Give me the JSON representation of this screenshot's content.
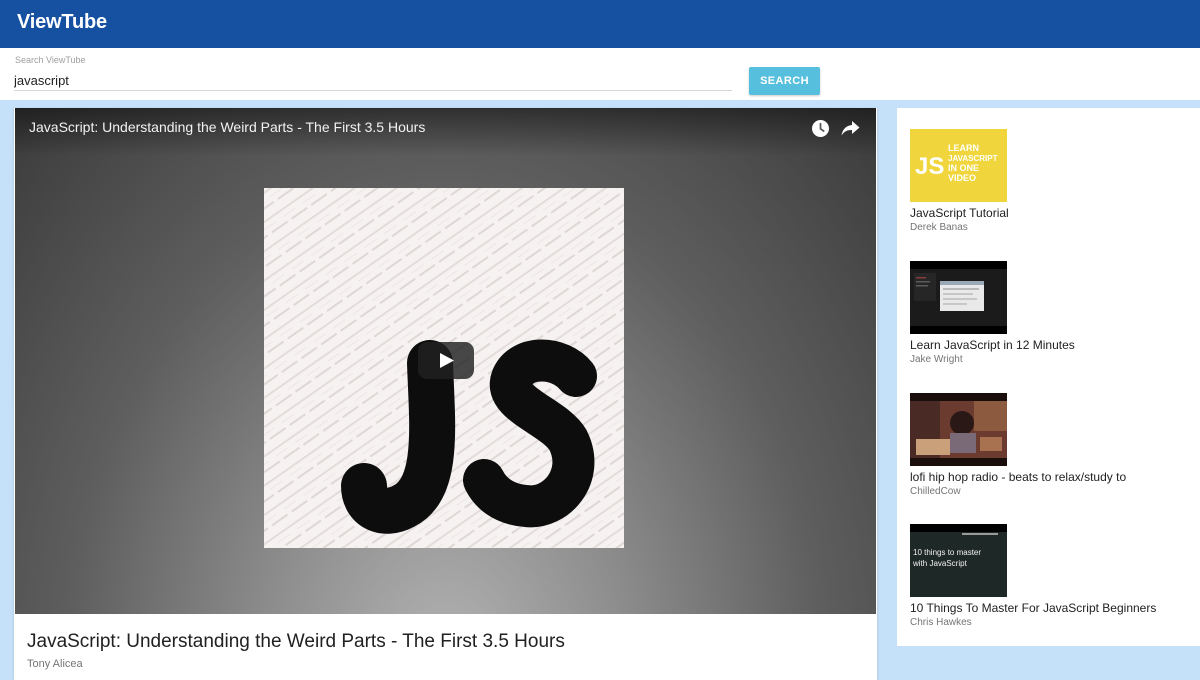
{
  "app": {
    "title": "ViewTube"
  },
  "search": {
    "label": "Search ViewTube",
    "value": "javascript",
    "button_label": "SEARCH"
  },
  "player": {
    "overlay_title": "JavaScript: Understanding the Weird Parts - The First 3.5 Hours"
  },
  "video": {
    "title": "JavaScript: Understanding the Weird Parts - The First 3.5 Hours",
    "channel": "Tony Alicea"
  },
  "related": [
    {
      "title": "JavaScript Tutorial",
      "channel": "Derek Banas",
      "thumb_text": "LEARN JAVASCRIPT IN ONE VIDEO"
    },
    {
      "title": "Learn JavaScript in 12 Minutes",
      "channel": "Jake Wright"
    },
    {
      "title": "lofi hip hop radio - beats to relax/study to",
      "channel": "ChilledCow"
    },
    {
      "title": "10 Things To Master For JavaScript Beginners",
      "channel": "Chris Hawkes",
      "thumb_text": "10 things to master with JavaScript"
    }
  ],
  "colors": {
    "appbar": "#1550a1",
    "background": "#c5e1f9",
    "search_button": "#56bfdd",
    "js_thumb": "#f0d63c"
  },
  "icons": [
    "clock-icon",
    "share-icon",
    "play-icon"
  ]
}
